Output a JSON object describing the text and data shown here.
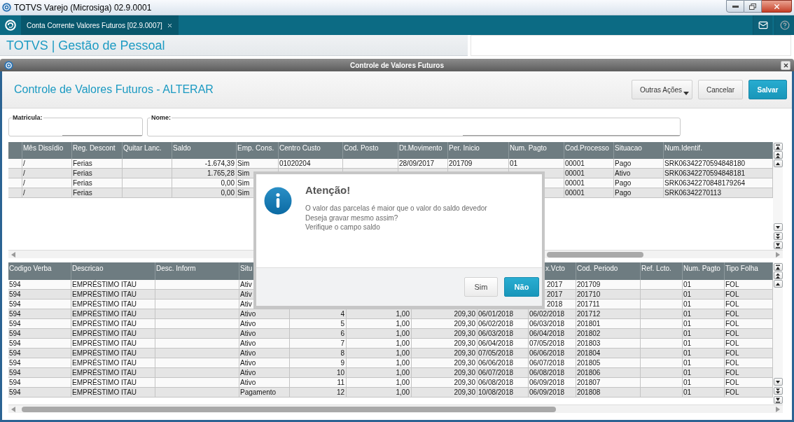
{
  "window": {
    "title": "TOTVS Varejo (Microsiga) 02.9.0001"
  },
  "tabs": [
    {
      "label": "Conta Corrente Valores Futuros [02.9.0007]",
      "selected": true
    }
  ],
  "module_header": {
    "title": "TOTVS | Gestão de Pessoal"
  },
  "form_window": {
    "title": "Controle de Valores Futuros",
    "heading": "Controle de Valores Futuros - ALTERAR",
    "actions": [
      {
        "label": "Outras Ações",
        "kind": "menu"
      },
      {
        "label": "Cancelar",
        "kind": "secondary"
      },
      {
        "label": "Salvar",
        "kind": "primary"
      }
    ],
    "fields": [
      {
        "label": "Matricula:"
      },
      {
        "label": "Nome:"
      }
    ],
    "upper_table": {
      "columns": [
        "Mês Dissídio",
        "Reg. Descont",
        "Quitar Lanc.",
        "Saldo",
        "Emp. Cons.",
        "Centro Custo",
        "Cod. Posto",
        "Dt.Movimento",
        "Per. Inicio",
        "Num. Pagto",
        "Cod.Processo",
        "Situacao",
        "Num.Identif."
      ],
      "rows": [
        [
          "/",
          "Ferias",
          null,
          "-1.674,39",
          "Sim",
          "01020204",
          null,
          "28/09/2017",
          "201709",
          "01",
          "00001",
          "Pago",
          "SRK06342270594848180"
        ],
        [
          "/",
          "Ferias",
          null,
          "1.765,28",
          "Sim",
          null,
          null,
          null,
          null,
          null,
          "00001",
          "Ativo",
          "SRK06342270594848181"
        ],
        [
          "/",
          "Ferias",
          null,
          "0,00",
          "Sim",
          null,
          null,
          null,
          null,
          null,
          "00001",
          "Pago",
          "SRK06342270848179264"
        ],
        [
          "/",
          "Ferias",
          null,
          "0,00",
          "Sim",
          null,
          null,
          null,
          null,
          null,
          "00001",
          "Pago",
          "SRK06342270113"
        ]
      ]
    },
    "lower_table": {
      "columns": [
        "Codigo Verba",
        "Descricao",
        "Desc. Inform",
        "Situ",
        null,
        null,
        null,
        null,
        "x.Vcto",
        "Cod. Periodo",
        "Ref. Lcto.",
        "Num. Pagto",
        "Tipo Folha"
      ],
      "rows": [
        [
          "594",
          "EMPRÉSTIMO ITAU",
          null,
          "Ativ",
          null,
          null,
          null,
          null,
          "2017",
          "201709",
          null,
          "01",
          "FOL"
        ],
        [
          "594",
          "EMPRÉSTIMO ITAU",
          null,
          "Ativ",
          null,
          null,
          null,
          null,
          "2017",
          "201710",
          null,
          "01",
          "FOL"
        ],
        [
          "594",
          "EMPRÉSTIMO ITAU",
          null,
          "Ativ",
          null,
          null,
          null,
          null,
          "2018",
          "201711",
          null,
          "01",
          "FOL"
        ],
        [
          "594",
          "EMPRÉSTIMO ITAU",
          null,
          "Ativo",
          "4",
          "1,00",
          "209,30",
          "06/01/2018",
          "06/02/2018",
          "201712",
          null,
          "01",
          "FOL"
        ],
        [
          "594",
          "EMPRÉSTIMO ITAU",
          null,
          "Ativo",
          "5",
          "1,00",
          "209,30",
          "06/02/2018",
          "06/03/2018",
          "201801",
          null,
          "01",
          "FOL"
        ],
        [
          "594",
          "EMPRÉSTIMO ITAU",
          null,
          "Ativo",
          "6",
          "1,00",
          "209,30",
          "06/03/2018",
          "06/04/2018",
          "201802",
          null,
          "01",
          "FOL"
        ],
        [
          "594",
          "EMPRÉSTIMO ITAU",
          null,
          "Ativo",
          "7",
          "1,00",
          "209,30",
          "06/04/2018",
          "07/05/2018",
          "201803",
          null,
          "01",
          "FOL"
        ],
        [
          "594",
          "EMPRÉSTIMO ITAU",
          null,
          "Ativo",
          "8",
          "1,00",
          "209,30",
          "07/05/2018",
          "06/06/2018",
          "201804",
          null,
          "01",
          "FOL"
        ],
        [
          "594",
          "EMPRÉSTIMO ITAU",
          null,
          "Ativo",
          "9",
          "1,00",
          "209,30",
          "06/06/2018",
          "06/07/2018",
          "201805",
          null,
          "01",
          "FOL"
        ],
        [
          "594",
          "EMPRÉSTIMO ITAU",
          null,
          "Ativo",
          "10",
          "1,00",
          "209,30",
          "06/07/2018",
          "06/08/2018",
          "201806",
          null,
          "01",
          "FOL"
        ],
        [
          "594",
          "EMPRÉSTIMO ITAU",
          null,
          "Ativo",
          "11",
          "1,00",
          "209,30",
          "06/08/2018",
          "06/09/2018",
          "201807",
          null,
          "01",
          "FOL"
        ],
        [
          "594",
          "EMPRÉSTIMO ITAU",
          null,
          "Pagamento",
          "12",
          "1,00",
          "209,30",
          "10/08/2018",
          "06/09/2018",
          "201808",
          null,
          "01",
          "FOL"
        ]
      ]
    }
  },
  "alert": {
    "title": "Atenção!",
    "message_lines": [
      "O valor das parcelas é maior que o valor do saldo devedor",
      "Deseja gravar mesmo assim?",
      "Verifique o campo saldo"
    ],
    "buttons": [
      {
        "label": "Sim",
        "kind": "secondary"
      },
      {
        "label": "Não",
        "kind": "primary"
      }
    ]
  }
}
